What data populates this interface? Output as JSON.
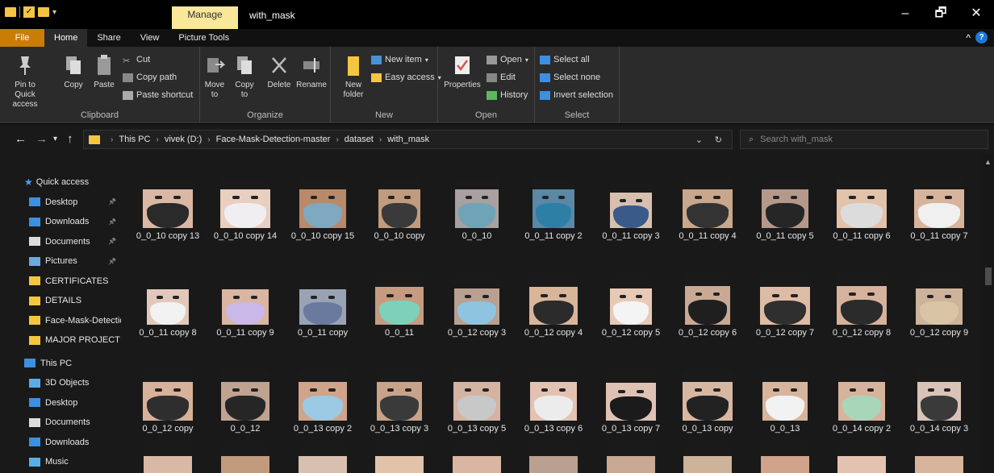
{
  "window": {
    "title": "with_mask",
    "contextual_tab": "Manage",
    "controls": {
      "minimize": "–",
      "maximize": "🗗",
      "close": "✕"
    }
  },
  "ribbon_tabs": [
    "File",
    "Home",
    "Share",
    "View",
    "Picture Tools"
  ],
  "ribbon": {
    "clipboard": {
      "label": "Clipboard",
      "pin": "Pin to Quick access",
      "copy": "Copy",
      "paste": "Paste",
      "cut": "Cut",
      "copy_path": "Copy path",
      "paste_shortcut": "Paste shortcut"
    },
    "organize": {
      "label": "Organize",
      "move_to": "Move to",
      "copy_to": "Copy to",
      "delete": "Delete",
      "rename": "Rename"
    },
    "new": {
      "label": "New",
      "new_folder": "New folder",
      "new_item": "New item",
      "easy_access": "Easy access"
    },
    "open": {
      "label": "Open",
      "properties": "Properties",
      "open": "Open",
      "edit": "Edit",
      "history": "History"
    },
    "select": {
      "label": "Select",
      "select_all": "Select all",
      "select_none": "Select none",
      "invert": "Invert selection"
    }
  },
  "address": {
    "segments": [
      "This PC",
      "vivek (D:)",
      "Face-Mask-Detection-master",
      "dataset",
      "with_mask"
    ],
    "search_placeholder": "Search with_mask"
  },
  "nav": {
    "quick_access": "Quick access",
    "items": [
      {
        "label": "Desktop",
        "icon": "desktop-icon",
        "pinned": true
      },
      {
        "label": "Downloads",
        "icon": "download-icon",
        "pinned": true
      },
      {
        "label": "Documents",
        "icon": "documents-icon",
        "pinned": true
      },
      {
        "label": "Pictures",
        "icon": "pictures-icon",
        "pinned": true
      },
      {
        "label": "CERTIFICATES",
        "icon": "folder-icon",
        "pinned": false
      },
      {
        "label": "DETAILS",
        "icon": "folder-icon",
        "pinned": false
      },
      {
        "label": "Face-Mask-Detectio",
        "icon": "folder-icon",
        "pinned": false
      },
      {
        "label": "MAJOR PROJECT",
        "icon": "folder-icon",
        "pinned": false
      }
    ],
    "this_pc": "This PC",
    "pc_items": [
      {
        "label": "3D Objects",
        "icon": "3d-objects-icon"
      },
      {
        "label": "Desktop",
        "icon": "desktop-icon"
      },
      {
        "label": "Documents",
        "icon": "documents-icon"
      },
      {
        "label": "Downloads",
        "icon": "download-icon"
      },
      {
        "label": "Music",
        "icon": "music-icon"
      }
    ]
  },
  "files": [
    "0_0_10 copy 13",
    "0_0_10 copy 14",
    "0_0_10 copy 15",
    "0_0_10 copy",
    "0_0_10",
    "0_0_11 copy 2",
    "0_0_11 copy 3",
    "0_0_11 copy 4",
    "0_0_11 copy 5",
    "0_0_11 copy 6",
    "0_0_11 copy 7",
    "0_0_11 copy 8",
    "0_0_11 copy 9",
    "0_0_11 copy",
    "0_0_11",
    "0_0_12 copy 3",
    "0_0_12 copy 4",
    "0_0_12 copy 5",
    "0_0_12 copy 6",
    "0_0_12 copy 7",
    "0_0_12 copy 8",
    "0_0_12 copy 9",
    "0_0_12 copy",
    "0_0_12",
    "0_0_13 copy 2",
    "0_0_13 copy 3",
    "0_0_13 copy 5",
    "0_0_13 copy 6",
    "0_0_13 copy 7",
    "0_0_13 copy",
    "0_0_13",
    "0_0_14 copy 2",
    "0_0_14 copy 3"
  ],
  "masks": [
    "#2a2a2a",
    "#f1eef2",
    "#7fa9c0",
    "#3a3a3a",
    "#6fa3b8",
    "#2d7fa6",
    "#3a5b8a",
    "#333333",
    "#262626",
    "#dcdcdc",
    "#f0f0f0",
    "#f2f2f2",
    "#c9b8e8",
    "#6a7a9e",
    "#7fd0b8",
    "#8fc4e0",
    "#2b2b2b",
    "#f4f4f4",
    "#1f1f1f",
    "#2f2f2f",
    "#2b2b2b",
    "#d9c4a6",
    "#2e2e2e",
    "#262626",
    "#9cc9e3",
    "#3a3a3a",
    "#c8c8c8",
    "#ececec",
    "#1b1b1b",
    "#222222",
    "#f2f2f2",
    "#a8d6b8",
    "#3a3a3a"
  ],
  "skins": [
    "#d9b8a5",
    "#e8cfc0",
    "#b88a6a",
    "#c19b7e",
    "#a9a0a0",
    "#5a88a6",
    "#d7c0b0",
    "#c9a78c",
    "#b4998a",
    "#e3c2aa",
    "#d8b49c",
    "#e2c8bb",
    "#d9b5a2",
    "#9aa3b6",
    "#c69b80",
    "#b9a091",
    "#d9b59a",
    "#e8c9b6",
    "#c9a994",
    "#ddbba5",
    "#d6b29c",
    "#cdb39a",
    "#d7b199",
    "#bfa391",
    "#cfa48b",
    "#c8a38a",
    "#d4b3a1",
    "#e4c2b2",
    "#e0c2b5",
    "#d8b7a0",
    "#d6b59c",
    "#d7b39d",
    "#d9c2b8"
  ],
  "partial_row_count": 11
}
